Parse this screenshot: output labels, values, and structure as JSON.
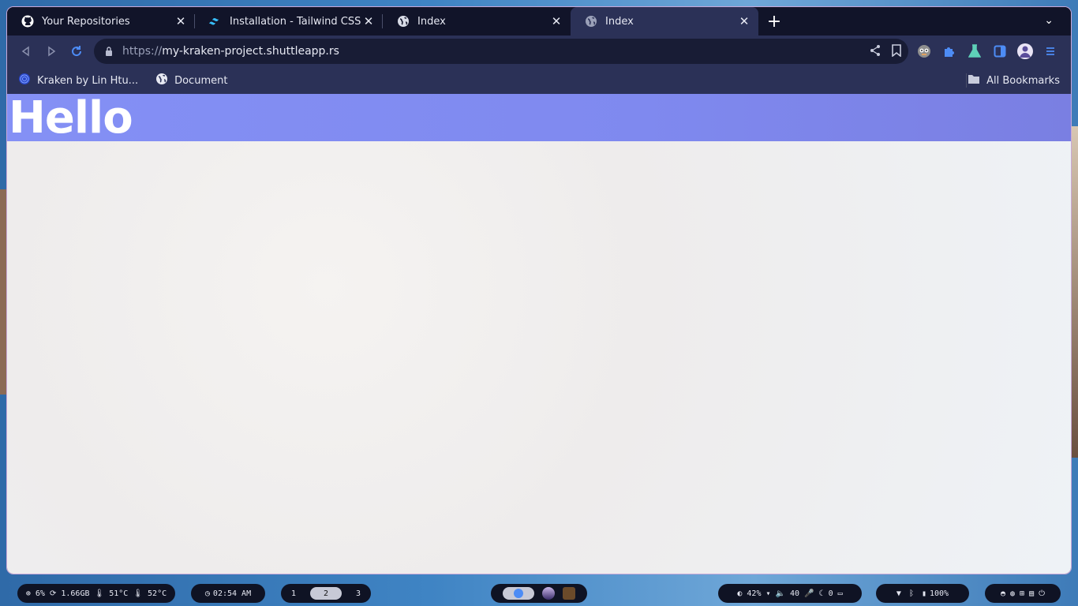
{
  "tabs": [
    {
      "title": "Your Repositories",
      "icon": "github-icon",
      "active": false
    },
    {
      "title": "Installation - Tailwind CSS",
      "icon": "tailwind-icon",
      "active": false
    },
    {
      "title": "Index",
      "icon": "globe-icon",
      "active": false
    },
    {
      "title": "Index",
      "icon": "globe-icon",
      "active": true
    }
  ],
  "address": {
    "scheme": "https://",
    "host": "my-kraken-project.shuttleapp.rs"
  },
  "bookmarks": [
    {
      "label": "Kraken by Lin Htu...",
      "icon": "kraken-icon"
    },
    {
      "label": "Document",
      "icon": "globe-icon"
    }
  ],
  "all_bookmarks_label": "All Bookmarks",
  "page": {
    "heading": "Hello"
  },
  "colors": {
    "hero": "#8490f5",
    "tab_active": "#2b3157",
    "reload": "#4d8cf5"
  },
  "taskbar": {
    "stats": "⊕ 6%  ⟳ 1.66GB  🌡 51°C  🌡 52°C",
    "clock": "02:54 AM",
    "workspaces": [
      "1",
      "2",
      "3"
    ],
    "active_workspace": "2",
    "system": "◐ 42%   ▾   🔈 40   🎤  ☾ 0   ▭",
    "battery": "100%"
  }
}
